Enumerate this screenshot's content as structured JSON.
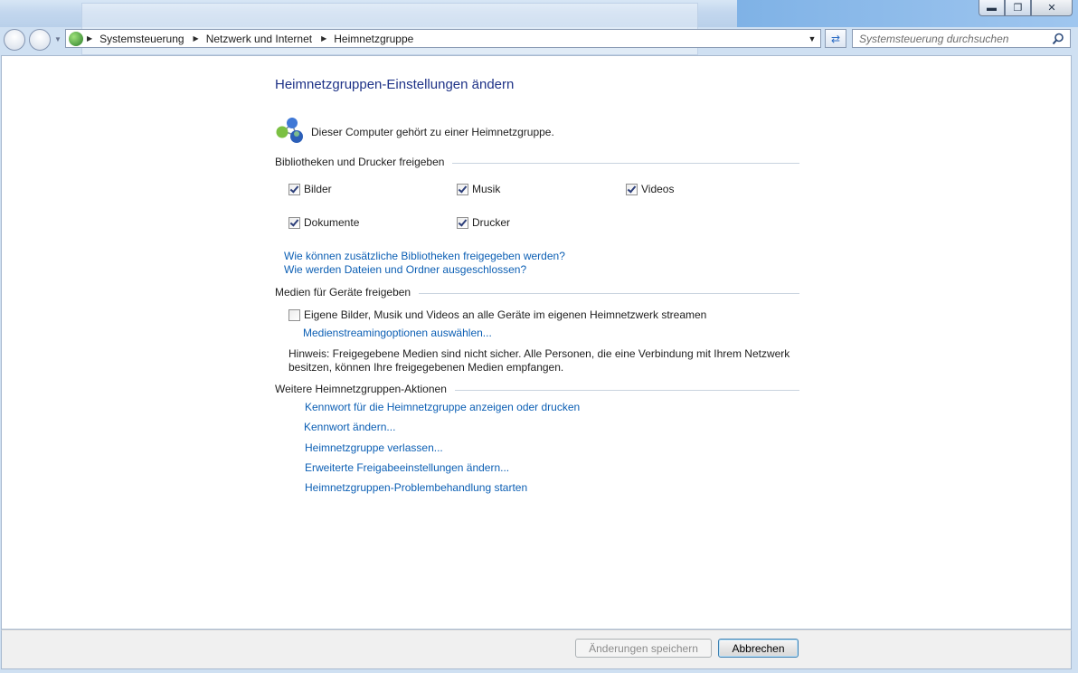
{
  "breadcrumb": [
    "Systemsteuerung",
    "Netzwerk und Internet",
    "Heimnetzgruppe"
  ],
  "search": {
    "placeholder": "Systemsteuerung durchsuchen"
  },
  "page": {
    "title": "Heimnetzgruppen-Einstellungen ändern",
    "membership_text": "Dieser Computer gehört zu einer Heimnetzgruppe."
  },
  "share": {
    "heading": "Bibliotheken und Drucker freigeben",
    "items": [
      {
        "label": "Bilder",
        "checked": true
      },
      {
        "label": "Musik",
        "checked": true
      },
      {
        "label": "Videos",
        "checked": true
      },
      {
        "label": "Dokumente",
        "checked": true
      },
      {
        "label": "Drucker",
        "checked": true
      }
    ],
    "link1": "Wie können zusätzliche Bibliotheken freigegeben werden?",
    "link2": "Wie werden Dateien und Ordner ausgeschlossen?"
  },
  "media": {
    "heading": "Medien für Geräte freigeben",
    "stream_label": "Eigene Bilder, Musik und Videos an alle Geräte im eigenen Heimnetzwerk streamen",
    "stream_checked": false,
    "options_link": "Medienstreamingoptionen auswählen...",
    "note": "Hinweis: Freigegebene Medien sind nicht sicher. Alle Personen, die eine Verbindung mit Ihrem Netzwerk besitzen, können Ihre freigegebenen Medien empfangen."
  },
  "actions": {
    "heading": "Weitere Heimnetzgruppen-Aktionen",
    "links": [
      "Kennwort für die Heimnetzgruppe anzeigen oder drucken",
      "Kennwort ändern...",
      "Heimnetzgruppe verlassen...",
      "Erweiterte Freigabeeinstellungen ändern...",
      "Heimnetzgruppen-Problembehandlung starten"
    ]
  },
  "footer": {
    "save_label": "Änderungen speichern",
    "cancel_label": "Abbrechen"
  },
  "colors": {
    "link": "#0c5fb4",
    "title": "#1e3287"
  }
}
